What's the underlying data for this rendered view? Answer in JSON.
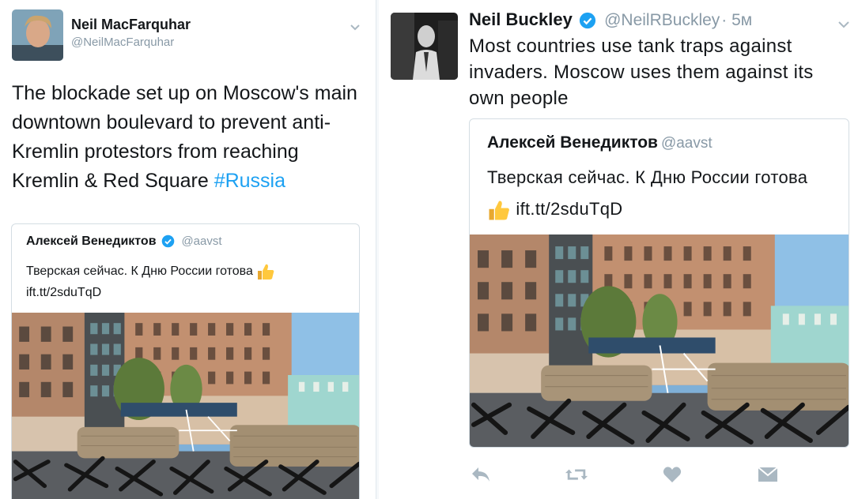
{
  "left_tweet": {
    "author_name": "Neil MacFarquhar",
    "author_handle": "@NeilMacFarquhar",
    "text": "The blockade set up on Moscow's main downtown boulevard to prevent anti-Kremlin protestors from reaching Kremlin & Red Square ",
    "hashtag": "#Russia",
    "quoted": {
      "author_name": "Алексей Венедиктов",
      "author_handle": "@aavst",
      "text": "Тверская сейчас. К Дню России готова",
      "link": "ift.tt/2sduTqD",
      "image_alt": "Tank traps and sandbags on Tverskaya street"
    }
  },
  "right_tweet": {
    "author_name": "Neil Buckley",
    "author_handle": "@NeilRBuckley",
    "timestamp": "· 5м",
    "text": "Most countries use tank traps against invaders. Moscow uses them against its own people",
    "quoted": {
      "author_name": "Алексей Венедиктов",
      "author_handle": "@aavst",
      "text": "Тверская сейчас. К Дню России готова",
      "link": "ift.tt/2sduTqD",
      "image_alt": "Tank traps and sandbags on Tverskaya street"
    },
    "actions": [
      "reply-icon",
      "retweet-icon",
      "like-icon",
      "dm-icon"
    ]
  },
  "colors": {
    "link": "#1da1f2",
    "muted": "#8899a6",
    "verified": "#1da1f2",
    "action_icon": "#aab8c2"
  }
}
